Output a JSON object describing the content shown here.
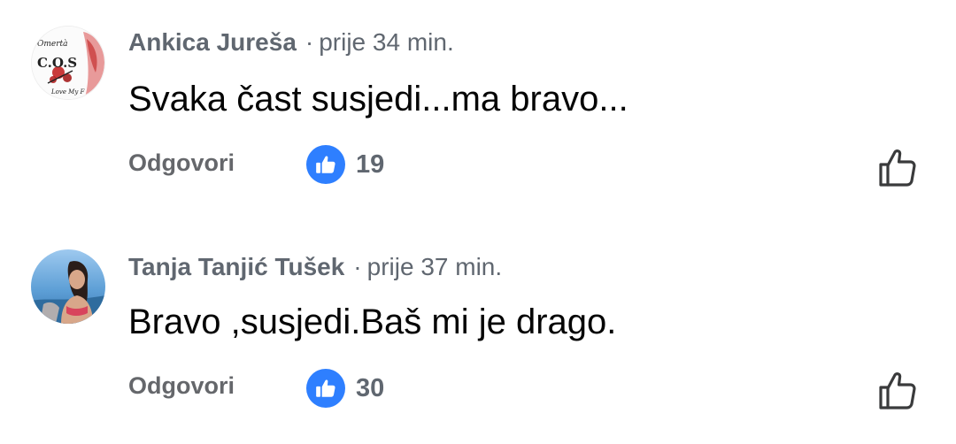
{
  "comments": [
    {
      "author": "Ankica Jureša",
      "separator": "·",
      "time": "prije 34 min.",
      "text": "Svaka čast susjedi...ma bravo...",
      "reply_label": "Odgovori",
      "like_count": "19",
      "avatar_text": {
        "top": "Omertà",
        "middle": "C.O.S",
        "bottom": "Love My F"
      }
    },
    {
      "author": "Tanja Tanjić Tušek",
      "separator": "·",
      "time": "prije 37 min.",
      "text": "Bravo ,susjedi.Baš mi je drago.",
      "reply_label": "Odgovori",
      "like_count": "30"
    }
  ],
  "icons": {
    "reaction": "like-reaction-icon",
    "action": "thumbs-up-outline-icon"
  },
  "colors": {
    "like_blue": "#2e7fff",
    "meta_gray": "#606770",
    "text_black": "#050505"
  }
}
